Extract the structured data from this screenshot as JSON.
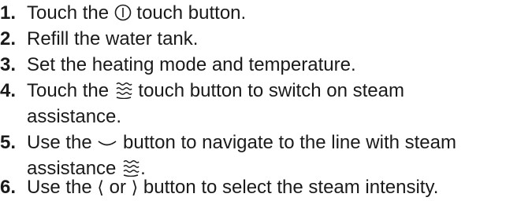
{
  "steps": [
    {
      "number": "1.",
      "before_icon": "Touch the ",
      "icon": "power-icon",
      "after_icon": " touch button."
    },
    {
      "number": "2.",
      "text": "Refill the water tank."
    },
    {
      "number": "3.",
      "text": "Set the heating mode and temperature."
    },
    {
      "number": "4.",
      "before_icon": "Touch the ",
      "icon": "steam-icon",
      "after_icon": " touch button to switch on steam",
      "continuation": "assistance."
    },
    {
      "number": "5.",
      "before_icon": "Use the ",
      "icon": "chevron-down-icon",
      "after_icon": " button to navigate to the line with steam",
      "continuation_before_icon": "assistance ",
      "continuation_icon": "steam-icon",
      "continuation_after_icon": "."
    },
    {
      "number": "6.",
      "before_icon": "Use the ",
      "icon": "chevron-left-icon",
      "glyph_left": "⟨",
      "middle": " or ",
      "icon_2": "chevron-right-icon",
      "glyph_right": "⟩",
      "after_icon": " button to select the steam intensity."
    }
  ]
}
